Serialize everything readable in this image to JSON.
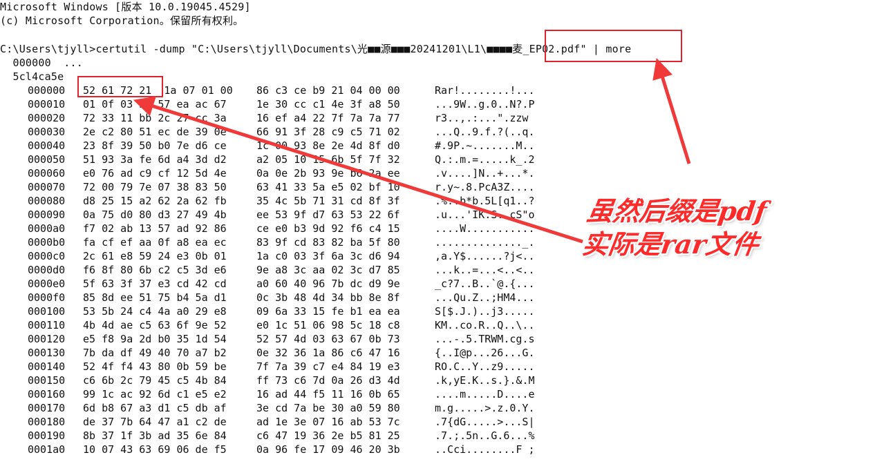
{
  "header": {
    "line1": "Microsoft Windows [版本 10.0.19045.4529]",
    "line2": "(c) Microsoft Corporation。保留所有权利。"
  },
  "command": {
    "prompt": "C:\\Users\\tjyll>",
    "text": "certutil -dump \"C:\\Users\\tjyll\\Documents\\光■■源■■■20241201\\L1\\■■■■麦_EP02.pdf\" | more"
  },
  "dump_header": {
    "line_a": "  000000  ...",
    "line_b": "  5cl4ca5e"
  },
  "rows": [
    {
      "offset": "000000",
      "hex1": "52 61 72 21  1a 07 01 00",
      "hex2": "86 c3 ce b9 21 04 00 00",
      "ascii": "Rar!........!..."
    },
    {
      "offset": "000010",
      "hex1": "01 0f 03 39 57 ea ac 67",
      "hex2": "1e 30 cc c1 4e 3f a8 50",
      "ascii": "...9W..g.0..N?.P"
    },
    {
      "offset": "000020",
      "hex1": "72 33 11 bb 2c 27 cc 3a",
      "hex2": "16 ef a4 22 7f 7a 7a 77",
      "ascii": "r3..,.:...\".zzw"
    },
    {
      "offset": "000030",
      "hex1": "2e c2 80 51 ec de 39 0e",
      "hex2": "66 91 3f 28 c9 c5 71 02",
      "ascii": "...Q..9.f.?(..q."
    },
    {
      "offset": "000040",
      "hex1": "23 8f 39 50 b0 7e d6 ce",
      "hex2": "1c 00 93 8e 2e 4d 8f d0",
      "ascii": "#.9P.~.......M.."
    },
    {
      "offset": "000050",
      "hex1": "51 93 3a fe 6d a4 3d d2",
      "hex2": "a2 05 10 15 6b 5f 7f 32",
      "ascii": "Q.:.m.=.....k_.2"
    },
    {
      "offset": "000060",
      "hex1": "e0 76 ad c9 cf 12 5d 4e",
      "hex2": "0a 0e 2b 93 9e b6 2a ee",
      "ascii": ".v....]N..+...*."
    },
    {
      "offset": "000070",
      "hex1": "72 00 79 7e 07 38 83 50",
      "hex2": "63 41 33 5a e5 02 bf 10",
      "ascii": "r.y~.8.PcA3Z...."
    },
    {
      "offset": "000080",
      "hex1": "d8 25 15 a2 62 2a 62 fb",
      "hex2": "35 4c 5b 71 31 cd 8f 3f",
      "ascii": ".%..b*b.5L[q1..?"
    },
    {
      "offset": "000090",
      "hex1": "0a 75 d0 80 d3 27 49 4b",
      "hex2": "ee 53 9f d7 63 53 22 6f",
      "ascii": ".u...'IK.S..cS\"o"
    },
    {
      "offset": "0000a0",
      "hex1": "f7 02 ab 13 57 ad 92 86",
      "hex2": "ce e0 b3 9d 92 f6 c4 15",
      "ascii": "....W..........."
    },
    {
      "offset": "0000b0",
      "hex1": "fa cf ef aa 0f a8 ea ec",
      "hex2": "83 9f cd 83 82 ba 5f 80",
      "ascii": ".............._."
    },
    {
      "offset": "0000c0",
      "hex1": "2c 61 e8 59 24 e3 0b 01",
      "hex2": "1a c0 03 3f 6a 3c d6 94",
      "ascii": ",a.Y$......?j<.."
    },
    {
      "offset": "0000d0",
      "hex1": "f6 8f 80 6b c2 c5 3d e6",
      "hex2": "9e a8 3c aa 02 3c d7 85",
      "ascii": "...k..=...<..<.."
    },
    {
      "offset": "0000e0",
      "hex1": "5f 63 3f 37 e3 cd 42 cd",
      "hex2": "a0 60 40 96 7b dc d9 9e",
      "ascii": "_c?7..B..`@.{..."
    },
    {
      "offset": "0000f0",
      "hex1": "85 8d ee 51 75 b4 5a d1",
      "hex2": "0c 3b 48 4d 34 bb 8e 8f",
      "ascii": "...Qu.Z..;HM4..."
    },
    {
      "offset": "000100",
      "hex1": "53 5b 24 c4 4a a0 29 e8",
      "hex2": "09 6a 33 15 fe b1 ea ea",
      "ascii": "S[$.J.)..j3....."
    },
    {
      "offset": "000110",
      "hex1": "4b 4d ae c5 63 6f 9e 52",
      "hex2": "e0 1c 51 06 98 5c 18 c8",
      "ascii": "KM..co.R..Q..\\.."
    },
    {
      "offset": "000120",
      "hex1": "e5 f8 9a 2d b0 35 1d 54",
      "hex2": "52 57 4d 03 63 67 0b 73",
      "ascii": "...-.5.TRWM.cg.s"
    },
    {
      "offset": "000130",
      "hex1": "7b da df 49 40 70 a7 b2",
      "hex2": "0e 32 36 1a 86 c6 47 16",
      "ascii": "{..I@p...26...G."
    },
    {
      "offset": "000140",
      "hex1": "52 4f f4 43 80 0b 59 be",
      "hex2": "7f 7a 39 c7 e4 84 19 e3",
      "ascii": "RO.C..Y..z9....."
    },
    {
      "offset": "000150",
      "hex1": "c6 6b 2c 79 45 c5 4b 84",
      "hex2": "ff 73 c6 7d 0a 26 d3 4d",
      "ascii": ".k,yE.K..s.}.&.M"
    },
    {
      "offset": "000160",
      "hex1": "99 1c ac 92 6d c1 e5 e2",
      "hex2": "16 ad 44 f5 11 16 0b 65",
      "ascii": "....m.....D....e"
    },
    {
      "offset": "000170",
      "hex1": "6d b8 67 a3 d1 c5 db af",
      "hex2": "3e cd 7a be 30 a0 59 80",
      "ascii": "m.g.....>.z.0.Y."
    },
    {
      "offset": "000180",
      "hex1": "de 37 7b 64 47 a1 c2 de",
      "hex2": "ad 1e 3e 07 16 ab 53 7c",
      "ascii": ".7{dG.....>...S|"
    },
    {
      "offset": "000190",
      "hex1": "8b 37 1f 3b ad 35 6e 84",
      "hex2": "c6 47 19 36 2e b5 81 25",
      "ascii": ".7.;.5n..G.6...%"
    },
    {
      "offset": "0001a0",
      "hex1": "10 07 43 63 69 06 de f5",
      "hex2": "0a 96 fe 17 09 46 20 3b",
      "ascii": "..Cci........F ;"
    }
  ],
  "annotation": {
    "line1": "虽然后缀是pdf",
    "line2": "实际是rar文件",
    "color": "#ff2a2a"
  },
  "colors": {
    "background": "#ffffff",
    "text": "#111111",
    "highlight": "#e0202a"
  }
}
